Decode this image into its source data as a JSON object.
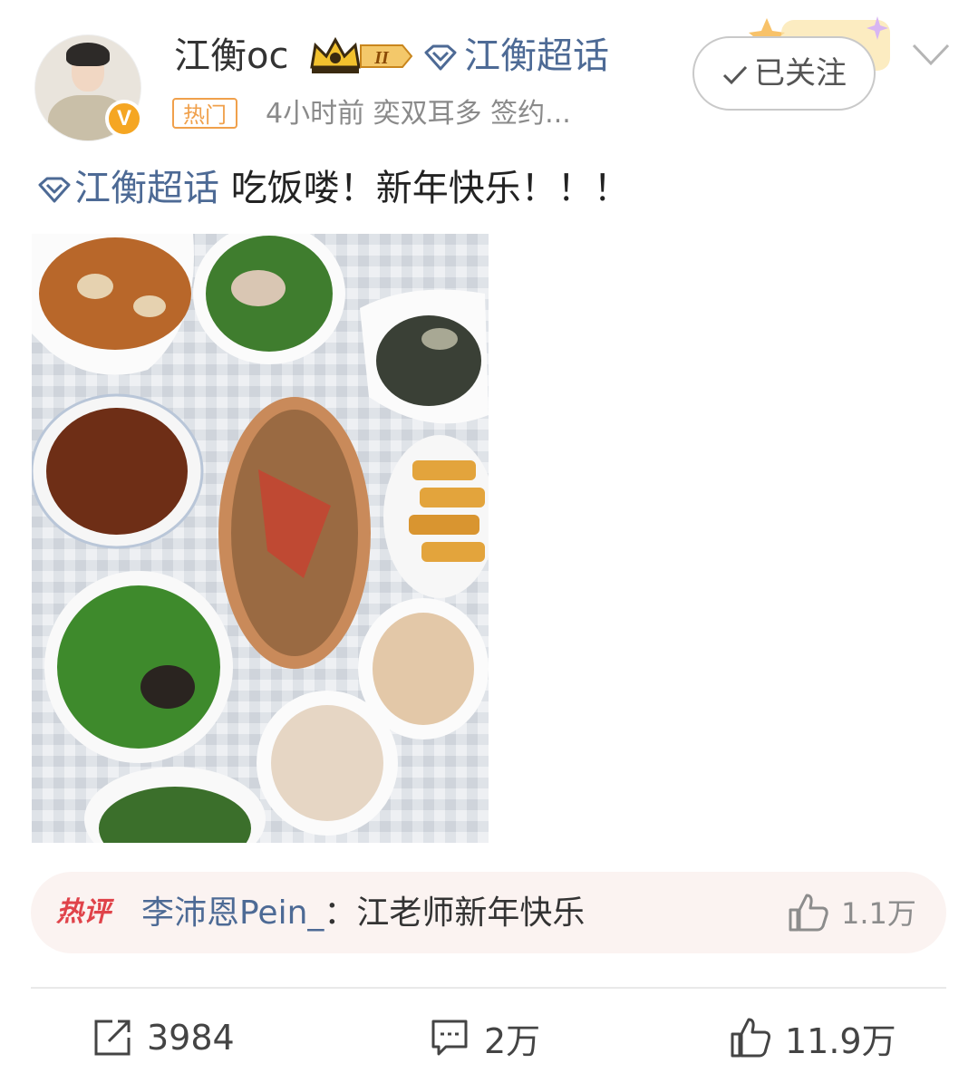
{
  "header": {
    "username": "江衡oc",
    "level_badge": "II",
    "topic_link": "江衡超话",
    "follow_button": "已关注",
    "hot_tag": "热门",
    "meta": "4小时前   奕双耳多 签约..."
  },
  "post": {
    "topic": "江衡超话",
    "text": " 吃饭喽！新年快乐！！！"
  },
  "hot_comment": {
    "label": "热评",
    "commenter": "李沛恩Pein_",
    "text": "：江老师新年快乐",
    "likes": "1.1万"
  },
  "actions": {
    "repost_count": "3984",
    "comment_count": "2万",
    "like_count": "11.9万"
  },
  "colors": {
    "link": "#4d6a95",
    "hot_tag": "#f0a04b",
    "hot_comment_label": "#e0434a",
    "verified_badge": "#f5a623"
  }
}
